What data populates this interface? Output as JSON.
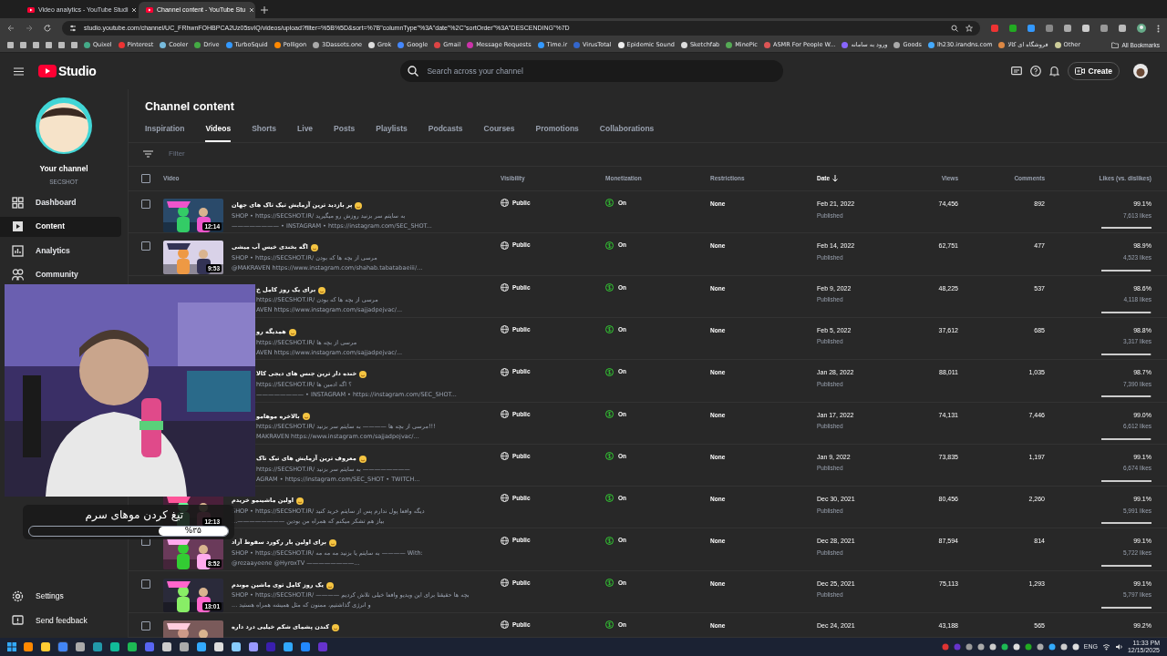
{
  "browser": {
    "tabs": [
      {
        "label": "Video analytics - YouTube Studi",
        "selected": false
      },
      {
        "label": "Channel content - YouTube Stu",
        "selected": true
      }
    ],
    "url": "studio.youtube.com/channel/UC_FRhwnFOHBPCA2Uz05svIQ/videos/upload?filter=%5B%5D&sort=%7B\"columnType\"%3A\"date\"%2C\"sortOrder\"%3A\"DESCENDING\"%7D",
    "bookmarks": [
      "Quixel",
      "Pinterest",
      "Cooler",
      "Drive",
      "TurboSquid",
      "Polligon",
      "3Dassets.one",
      "Grok",
      "Google",
      "Gmail",
      "Message Requests",
      "Time.ir",
      "VirusTotal",
      "Epidemic Sound",
      "Sketchfab",
      "MinePic",
      "ASMR For People W...",
      "ورود به سامانه",
      "Goods",
      "lh230.irandns.com",
      "فروشگاه ای کالا",
      "Other"
    ],
    "all_bookmarks": "All Bookmarks"
  },
  "header": {
    "logo": "Studio",
    "search_placeholder": "Search across your channel",
    "create": "Create"
  },
  "sidebar": {
    "channel_label": "Your channel",
    "channel_name": "SECSHOT",
    "items": [
      {
        "label": "Dashboard",
        "selected": false
      },
      {
        "label": "Content",
        "selected": true
      },
      {
        "label": "Analytics",
        "selected": false
      },
      {
        "label": "Community",
        "selected": false
      }
    ],
    "bottom_items": [
      {
        "label": "Settings"
      },
      {
        "label": "Send feedback"
      }
    ]
  },
  "title": "Channel content",
  "tabs": [
    {
      "label": "Inspiration",
      "selected": false
    },
    {
      "label": "Videos",
      "selected": true
    },
    {
      "label": "Shorts",
      "selected": false
    },
    {
      "label": "Live",
      "selected": false
    },
    {
      "label": "Posts",
      "selected": false
    },
    {
      "label": "Playlists",
      "selected": false
    },
    {
      "label": "Podcasts",
      "selected": false
    },
    {
      "label": "Courses",
      "selected": false
    },
    {
      "label": "Promotions",
      "selected": false
    },
    {
      "label": "Collaborations",
      "selected": false
    }
  ],
  "filter_placeholder": "Filter",
  "table": {
    "select_all": {
      "checked": false
    },
    "columns": [
      "Video",
      "Visibility",
      "Monetization",
      "Restrictions",
      "Date",
      "Views",
      "Comments",
      "Likes (vs. dislikes)"
    ],
    "rows": [
      {
        "kind": "full",
        "checked": false,
        "title": "پر بازدید ترین آزمایش تیک تاک های جهان",
        "desc": [
          "SHOP • https://SECSHOT.IR/ به سایتم سر بزنید روزش رو میگیرید",
          "———————— • INSTAGRAM • https://instagram.com/SEC_SHOT..."
        ],
        "duration": "12:14",
        "visibility": "Public",
        "monetization": "On",
        "restrictions": "None",
        "date": "Feb 21, 2022",
        "status": "Published",
        "views": "74,456",
        "comments": "892",
        "likes_pct": "99.1%",
        "likes": "7,613 likes",
        "level": 0.991
      },
      {
        "kind": "full",
        "checked": false,
        "title": "اگه بخندی خیس آب میشی",
        "desc": [
          "SHOP • https://SECSHOT.IR/ مرسی از بچه ها که بودن",
          "@MAKRAVEN https://www.instagram.com/shahab.tabatabaeiii/..."
        ],
        "duration": "9:53",
        "visibility": "Public",
        "monetization": "On",
        "restrictions": "None",
        "date": "Feb 14, 2022",
        "status": "Published",
        "views": "62,751",
        "comments": "477",
        "likes_pct": "98.9%",
        "likes": "4,523 likes",
        "level": 0.989
      },
      {
        "kind": "covered",
        "title": "برای یک روز کامل خ",
        "desc": [
          "https://SECSHOT.IR/ مرسی از بچه ها که بودن",
          "AVEN https://www.instagram.com/sajjadpejvac/..."
        ],
        "visibility": "Public",
        "monetization": "On",
        "restrictions": "None",
        "date": "Feb 9, 2022",
        "status": "Published",
        "views": "48,225",
        "comments": "537",
        "likes_pct": "98.6%",
        "likes": "4,118 likes",
        "level": 0.986
      },
      {
        "kind": "covered",
        "title": "همدیگه رو",
        "desc": [
          "https://SECSHOT.IR/ مرسی از بچه ها",
          "AVEN https://www.instagram.com/sajjadpejvac/..."
        ],
        "visibility": "Public",
        "monetization": "On",
        "restrictions": "None",
        "date": "Feb 5, 2022",
        "status": "Published",
        "views": "37,612",
        "comments": "685",
        "likes_pct": "98.8%",
        "likes": "3,317 likes",
        "level": 0.988
      },
      {
        "kind": "covered",
        "title": "خنده دار ترین جنس های دیجی کالا",
        "desc": [
          "https://SECSHOT.IR/ ؟ اگه ادمین ها",
          "———————— • INSTAGRAM • https://instagram.com/SEC_SHOT..."
        ],
        "visibility": "Public",
        "monetization": "On",
        "restrictions": "None",
        "date": "Jan 28, 2022",
        "status": "Published",
        "views": "88,011",
        "comments": "1,035",
        "likes_pct": "98.7%",
        "likes": "7,390 likes",
        "level": 0.987
      },
      {
        "kind": "covered",
        "title": "بالاخره موهامو",
        "desc": [
          "https://SECSHOT.IR/ مرسی از بچه ها ———— به سایتم سر بزنید!!!",
          "MAKRAVEN https://www.instagram.com/sajjadpejvac/..."
        ],
        "visibility": "Public",
        "monetization": "On",
        "restrictions": "None",
        "date": "Jan 17, 2022",
        "status": "Published",
        "views": "74,131",
        "comments": "7,446",
        "likes_pct": "99.0%",
        "likes": "6,612 likes",
        "level": 0.99
      },
      {
        "kind": "covered",
        "title": "معروف ترین آزمایش های تیک تاک",
        "desc": [
          "https://SECSHOT.IR/ به سایتم سر بزنید ————————",
          "AGRAM • https://instagram.com/SEC_SHOT • TWITCH..."
        ],
        "visibility": "Public",
        "monetization": "On",
        "restrictions": "None",
        "date": "Jan 9, 2022",
        "status": "Published",
        "views": "73,835",
        "comments": "1,197",
        "likes_pct": "99.1%",
        "likes": "6,674 likes",
        "level": 0.991
      },
      {
        "kind": "partial",
        "title": "اولین ماشینمو خریدم",
        "desc": [
          "SHOP • https://SECSHOT.IR/ دیگه واقعا پول ندارم پس از سایتم خرید کنید",
          "بیاز هم تشکر میکنم که همراه من بودین ————————..."
        ],
        "duration": "12:13",
        "visibility": "Public",
        "monetization": "On",
        "restrictions": "None",
        "date": "Dec 30, 2021",
        "status": "Published",
        "views": "80,456",
        "comments": "2,260",
        "likes_pct": "99.1%",
        "likes": "5,991 likes",
        "level": 0.991
      },
      {
        "kind": "full",
        "checked": false,
        "title": "برای اولین بار رکورد سقوط آزاد",
        "desc": [
          "SHOP • https://SECSHOT.IR/ به سایتم یا بزنید مه مه مه ———— With:",
          "@rezaayeene @HyroxTV ————————..."
        ],
        "duration": "8:52",
        "visibility": "Public",
        "monetization": "On",
        "restrictions": "None",
        "date": "Dec 28, 2021",
        "status": "Published",
        "views": "87,594",
        "comments": "814",
        "likes_pct": "99.1%",
        "likes": "5,722 likes",
        "level": 0.991
      },
      {
        "kind": "full",
        "checked": false,
        "title": "یک روز کامل توی ماشین موندم",
        "desc": [
          "SHOP • https://SECSHOT.IR/ ———— بچه ها حقیقتا برای این ویدیو واقعا خیلی تلاش کردیم",
          "و انرژی گذاشتیم، ممنون که مثل همیشه همراه هستید ..."
        ],
        "duration": "13:01",
        "visibility": "Public",
        "monetization": "On",
        "restrictions": "None",
        "date": "Dec 25, 2021",
        "status": "Published",
        "views": "75,113",
        "comments": "1,293",
        "likes_pct": "99.1%",
        "likes": "5,797 likes",
        "level": 0.991
      },
      {
        "kind": "cut",
        "checked": false,
        "title": "کندن پشمای شکم خیلیی درد داره",
        "visibility": "Public",
        "monetization": "On",
        "restrictions": "None",
        "date": "Dec 24, 2021",
        "views": "43,188",
        "comments": "565",
        "likes_pct": "99.2%"
      }
    ]
  },
  "overlay": {
    "caption": "تیغ کردن موهای سرم",
    "progress_label": "%۳۵",
    "level": 0.35
  },
  "taskbar": {
    "language": "ENG",
    "time": "11:33 PM",
    "date": "12/15/2025"
  }
}
